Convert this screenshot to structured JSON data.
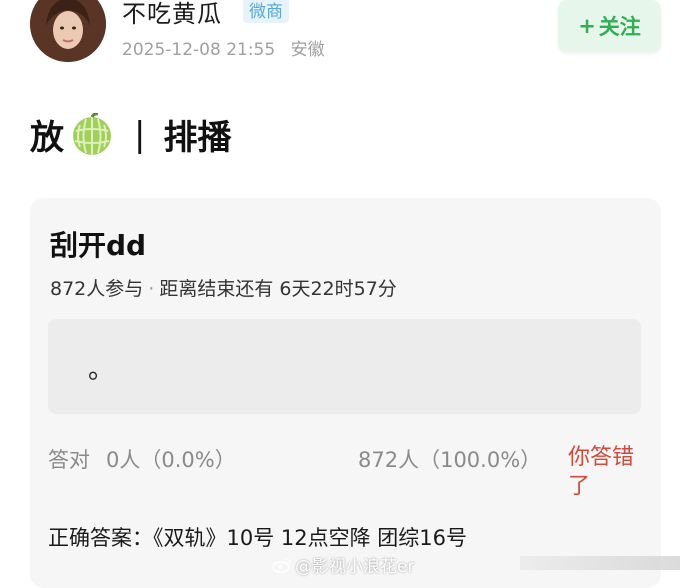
{
  "header": {
    "username": "不吃黄瓜",
    "badge": "微商",
    "timestamp": "2025-12-08 21:55",
    "location": "安徽",
    "follow_plus": "+",
    "follow_label": "关注"
  },
  "post": {
    "text_before": "放",
    "emoji": "melon-icon",
    "separator": "|",
    "text_after": "排播"
  },
  "poll": {
    "title": "刮开dd",
    "participants": "872人参与",
    "dot": "·",
    "countdown": "距离结束还有 6天22时57分",
    "option_text": "。",
    "correct_label": "答对",
    "correct_value": "0人（0.0%）",
    "wrong_value": "872人（100.0%）",
    "user_status": "你答错了",
    "answer": "正确答案：《双轨》10号 12点空降 团综16号"
  },
  "watermark": {
    "text": "@影视小浪花er"
  },
  "colors": {
    "follow_green": "#2fae53",
    "follow_bg": "#e6f6ea",
    "wrong_red": "#d14a3c",
    "badge_blue": "#5aa7d0",
    "card_bg": "#f6f6f6"
  }
}
